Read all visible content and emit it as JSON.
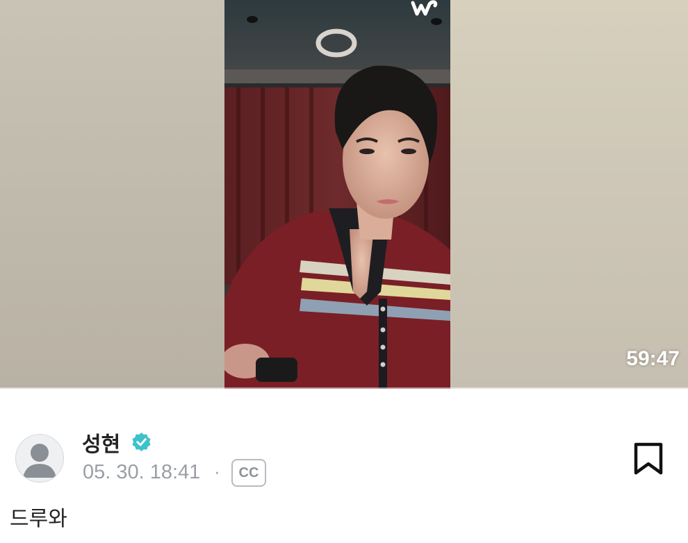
{
  "video": {
    "duration": "59:47",
    "brand_icon": "weverse-w-icon"
  },
  "post": {
    "author": "성현",
    "verified_icon": "verified-badge-icon",
    "date": "05. 30. 18:41",
    "separator": "·",
    "cc_label": "CC",
    "caption": "드루와",
    "bookmark_icon": "bookmark-icon",
    "avatar_icon": "default-avatar-icon"
  },
  "colors": {
    "verified": "#3ec1cb",
    "muted_text": "#9a9fa5",
    "text": "#222222"
  }
}
